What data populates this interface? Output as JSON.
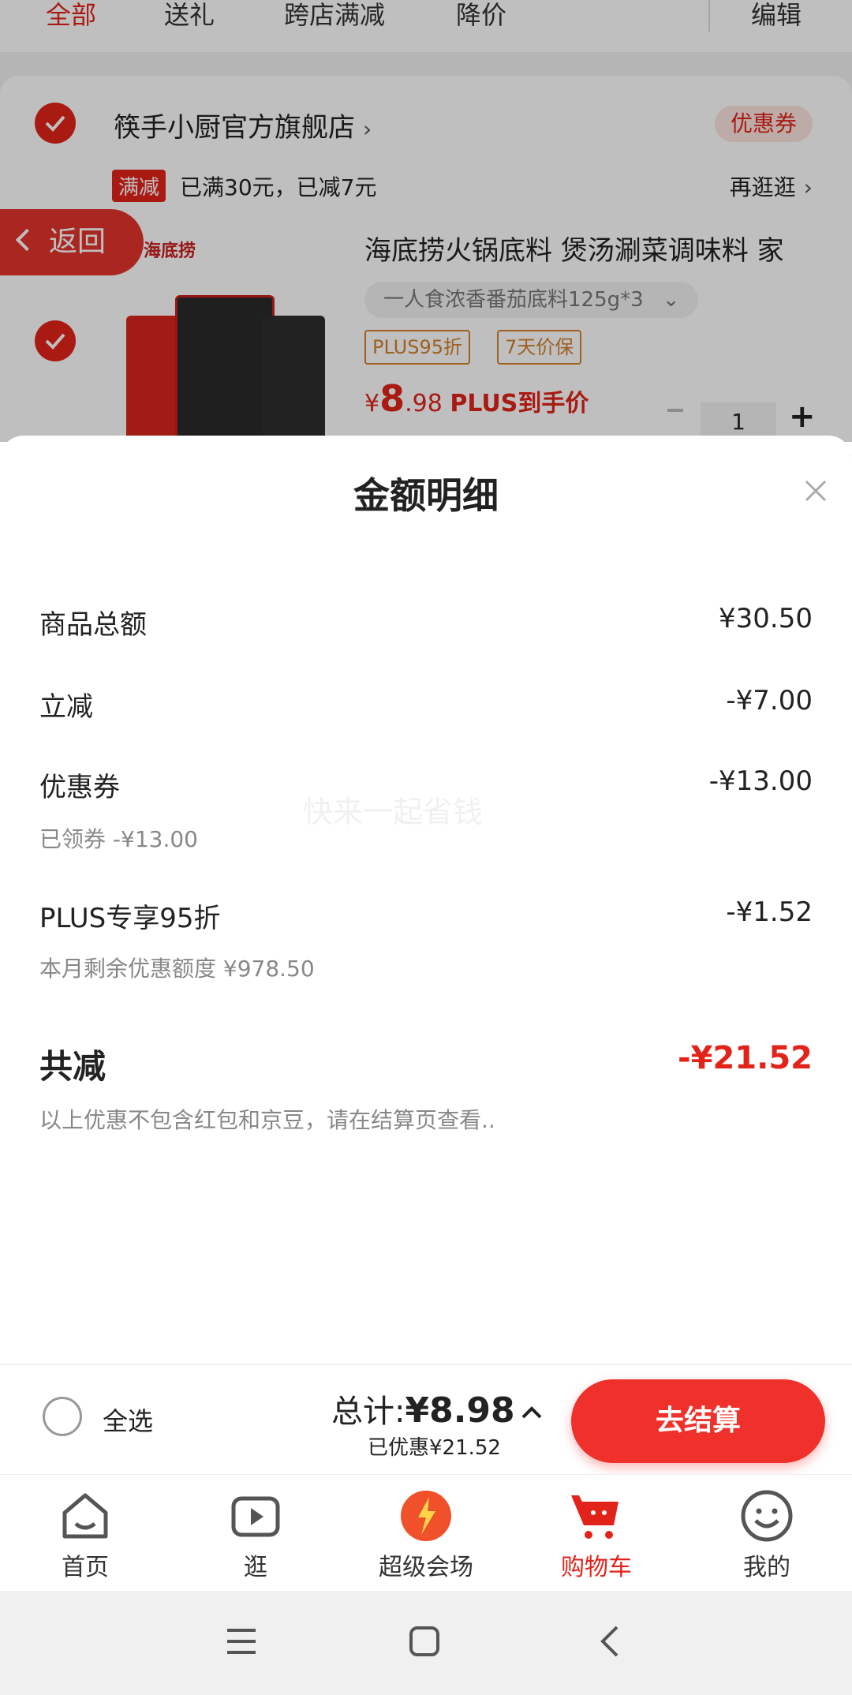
{
  "tabs": [
    "全部",
    "送礼",
    "跨店满减",
    "降价",
    "编辑"
  ],
  "shop": {
    "name": "筷手小厨官方旗舰店",
    "coupon_label": "优惠券",
    "promo_tag": "满减",
    "promo_text": "已满30元，已减7元",
    "more_label": "再逛逛"
  },
  "back_label": "返回",
  "product": {
    "brand": "海底捞",
    "title": "海底捞火锅底料 煲汤涮菜调味料 家",
    "variant": "一人食浓香番茄底料125g*3",
    "tag_plus": "PLUS95折",
    "tag_price": "7天价保",
    "price_symbol": "¥",
    "price_int": "8",
    "price_dec": ".98",
    "price_note": "PLUS到手价",
    "quantity": "1"
  },
  "sheet": {
    "title": "金额明细",
    "rows": [
      {
        "label": "商品总额",
        "value": "¥30.50"
      },
      {
        "label": "立减",
        "value": "-¥7.00"
      },
      {
        "label": "优惠券",
        "value": "-¥13.00",
        "sub": "已领券 -¥13.00"
      },
      {
        "label": "PLUS专享95折",
        "value": "-¥1.52",
        "sub": "本月剩余优惠额度 ¥978.50"
      }
    ],
    "watermark": "快来一起省钱",
    "total_label": "共减",
    "total_value": "-¥21.52",
    "note": "以上优惠不包含红包和京豆，请在结算页查看.."
  },
  "checkout": {
    "select_all": "全选",
    "total_prefix": "总计:",
    "total_value": "¥8.98",
    "saved": "已优惠¥21.52",
    "button": "去结算"
  },
  "tabbar": [
    {
      "label": "首页",
      "icon": "home-icon"
    },
    {
      "label": "逛",
      "icon": "video-play-icon"
    },
    {
      "label": "超级会场",
      "icon": "super-venue-icon"
    },
    {
      "label": "购物车",
      "icon": "cart-icon"
    },
    {
      "label": "我的",
      "icon": "profile-icon"
    }
  ],
  "colors": {
    "accent": "#e2231a",
    "tag": "#d4812b"
  }
}
